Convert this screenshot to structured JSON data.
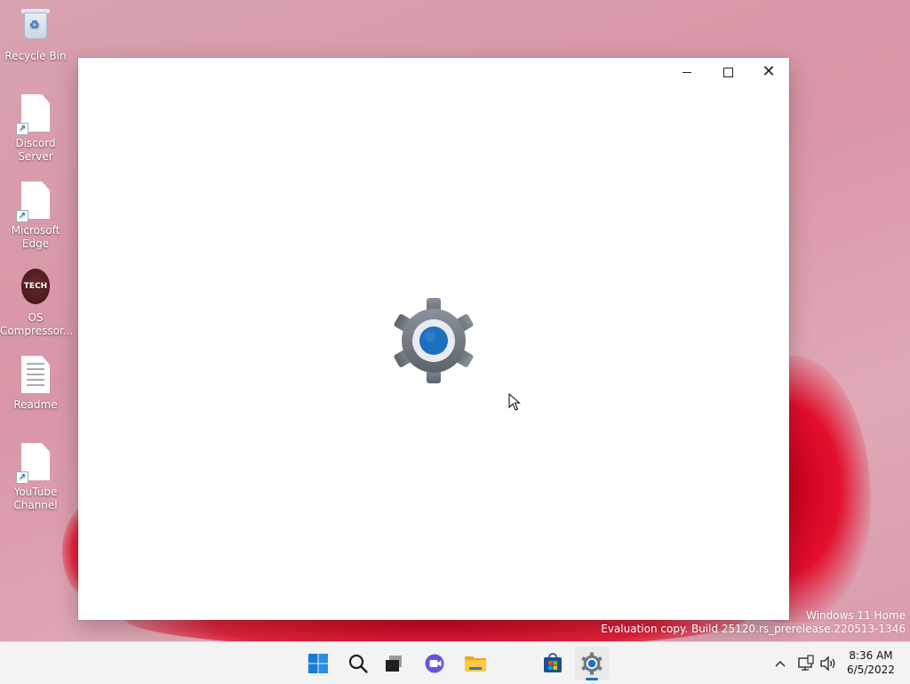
{
  "desktop": {
    "icons": [
      {
        "label": "Recycle Bin"
      },
      {
        "label": "Discord Server"
      },
      {
        "label": "Microsoft Edge"
      },
      {
        "label": "OS Compressor...",
        "badge_text": "TECH"
      },
      {
        "label": "Readme"
      },
      {
        "label": "YouTube Channel"
      }
    ]
  },
  "window": {
    "caption": {
      "minimize": "",
      "maximize": "",
      "close": "✕"
    },
    "splash_icon": "settings-gear-icon",
    "accent": "#1f6fbf",
    "gear_color": "#6f7780"
  },
  "watermark": {
    "line1": "Windows 11 Home",
    "line2": "Evaluation copy. Build 25120.rs_prerelease.220513-1346"
  },
  "taskbar": {
    "icons": [
      "start-icon",
      "search-icon",
      "task-view-icon",
      "chat-icon",
      "file-explorer-icon",
      "store-icon",
      "settings-icon"
    ],
    "active": "settings-icon",
    "tray": {
      "time": "8:36 AM",
      "date": "6/5/2022"
    }
  }
}
